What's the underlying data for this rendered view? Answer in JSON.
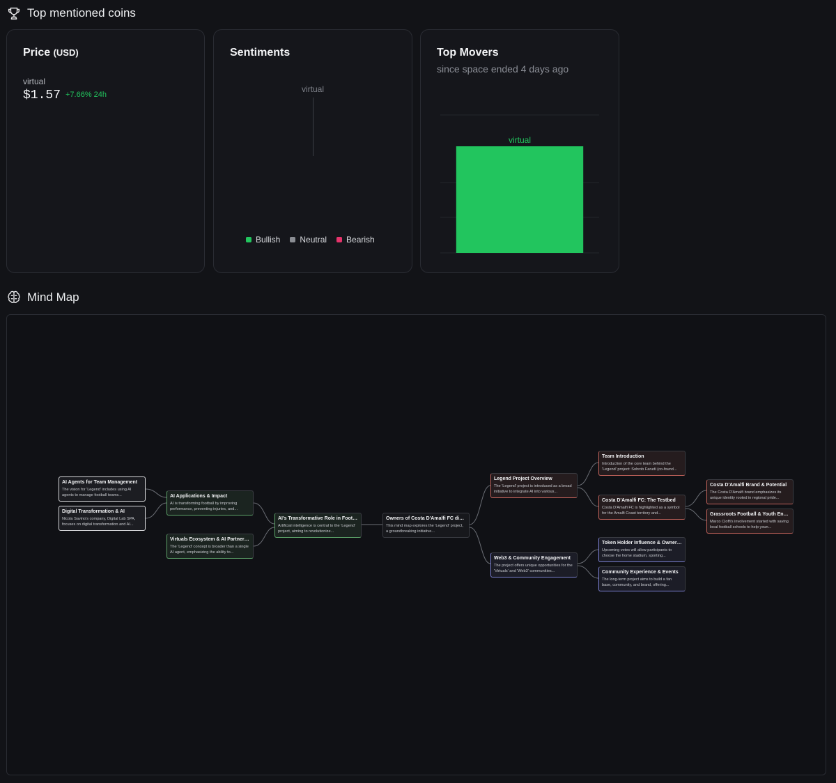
{
  "top_coins": {
    "title": "Top mentioned coins",
    "icon": "trophy-icon"
  },
  "price_card": {
    "title": "Price",
    "unit": "(USD)",
    "coin": "virtual",
    "price": "$1.57",
    "change": "+7.66% 24h"
  },
  "sentiments": {
    "title": "Sentiments",
    "coin": "virtual",
    "legend": [
      {
        "label": "Bullish",
        "color": "#22c55e"
      },
      {
        "label": "Neutral",
        "color": "#8a8d93"
      },
      {
        "label": "Bearish",
        "color": "#e6336b"
      }
    ]
  },
  "top_movers": {
    "title": "Top Movers",
    "subtitle": "since space ended 4 days ago",
    "chart_data": {
      "type": "bar",
      "categories": [
        "virtual"
      ],
      "values": [
        7.66
      ],
      "color": "#22c55e"
    }
  },
  "mind_map": {
    "title": "Mind Map",
    "icon": "brain-icon",
    "nodes": {
      "root": {
        "title": "Owners of Costa D'Amalfi FC disc...",
        "desc": "This mind map explores the 'Legend' project, a groundbreaking initiative..."
      },
      "ai_role": {
        "title": "AI's Transformative Role in Football",
        "desc": "Artificial intelligence is central to the 'Legend' project, aiming to revolutionize..."
      },
      "ai_apps": {
        "title": "AI Applications & Impact",
        "desc": "AI is transforming football by improving performance, preventing injuries, and..."
      },
      "virtuals": {
        "title": "Virtuals Ecosystem & AI Partnersh...",
        "desc": "The 'Legend' concept is broader than a single AI agent, emphasizing the ability to..."
      },
      "ai_agents": {
        "title": "AI Agents for Team Management",
        "desc": "The vision for 'Legend' includes using AI agents to manage football teams..."
      },
      "digital": {
        "title": "Digital Transformation & AI",
        "desc": "Nicola Savino's company, Digital Lab SPA, focuses on digital transformation and AI..."
      },
      "legend": {
        "title": "Legend Project Overview",
        "desc": "The 'Legend' project is introduced as a broad initiative to integrate AI into various..."
      },
      "web3": {
        "title": "Web3 & Community Engagement",
        "desc": "The project offers unique opportunities for the 'Virtuals' and 'Web3' communities..."
      },
      "team": {
        "title": "Team Introduction",
        "desc": "Introduction of the core team behind the 'Legend' project: Sohrob Farudi (co-found..."
      },
      "testbed": {
        "title": "Costa D'Amalfi FC: The Testbed",
        "desc": "Costa D'Amalfi FC is highlighted as a symbol for the Amalfi Coast territory and..."
      },
      "token": {
        "title": "Token Holder Influence & Owners...",
        "desc": "Upcoming votes will allow participants to choose the home stadium, sporting..."
      },
      "community": {
        "title": "Community Experience & Events",
        "desc": "The long-term project aims to build a fan base, community, and brand, offering..."
      },
      "brand": {
        "title": "Costa D'Amalfi Brand & Potential",
        "desc": "The Costa D'Amalfi brand emphasizes its unique identity rooted in regional pride..."
      },
      "grassroots": {
        "title": "Grassroots Football & Youth Enga...",
        "desc": "Marco Cioffi's involvement started with saving local football schools to help youn..."
      }
    }
  }
}
